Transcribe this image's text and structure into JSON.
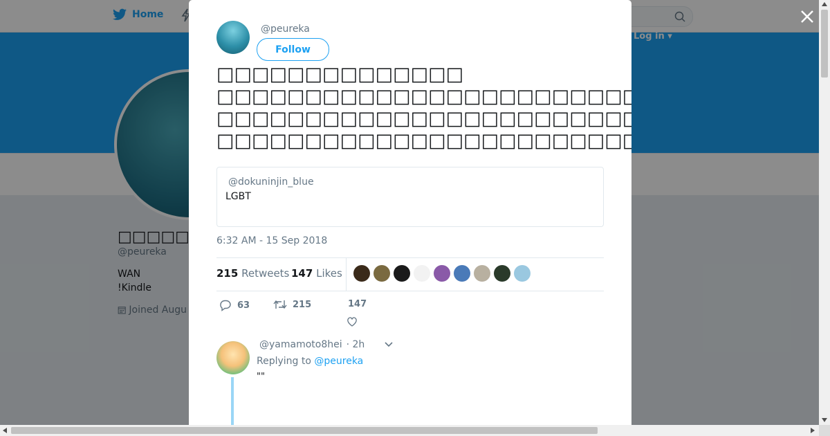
{
  "nav": {
    "home_label": "Home",
    "login_label": "Log in ▾"
  },
  "profile": {
    "name": "□□□□□",
    "handle": "@peureka",
    "bio_line1": "WAN",
    "bio_line2": "!Kindle",
    "joined": "Joined Augu"
  },
  "tweet": {
    "handle": "@peureka",
    "follow_label": "Follow",
    "text_lines": [
      "□□□□□□□□□□□□□□",
      "□□□□□□□□□□□□□□□□□□□□□□□□□□□□□□□□□□□□□□",
      "□□□□□□□□□□□□□□□□□□□□□□□□□□□□□□□□□□□□□□□□□",
      "□□□□□□□□□□□□□□□□□□□□□□□□□□□□□□□□□□□□□□□□□□□□□□"
    ],
    "quote": {
      "handle": "@dokuninjin_blue",
      "text": "LGBT"
    },
    "time": "6:32 AM - 15 Sep 2018",
    "retweets_count": "215",
    "retweets_label": "Retweets",
    "likes_count": "147",
    "likes_label": "Likes",
    "liker_colors": [
      "#3a2a1a",
      "#7a6a40",
      "#1a1a1a",
      "#f2f2f2",
      "#8a5aa8",
      "#4a7ab8",
      "#b8b0a0",
      "#2a3a2a",
      "#9ac8e0"
    ],
    "reply_count": "63",
    "retweet_action_count": "215",
    "like_action_count": "147"
  },
  "reply": {
    "handle": "@yamamoto8hei",
    "time": "· 2h",
    "replying_prefix": "Replying to",
    "replying_handle": "@peureka",
    "text": "\"\""
  },
  "colors": {
    "brand": "#1da1f2",
    "text": "#14171a",
    "muted": "#657786"
  }
}
